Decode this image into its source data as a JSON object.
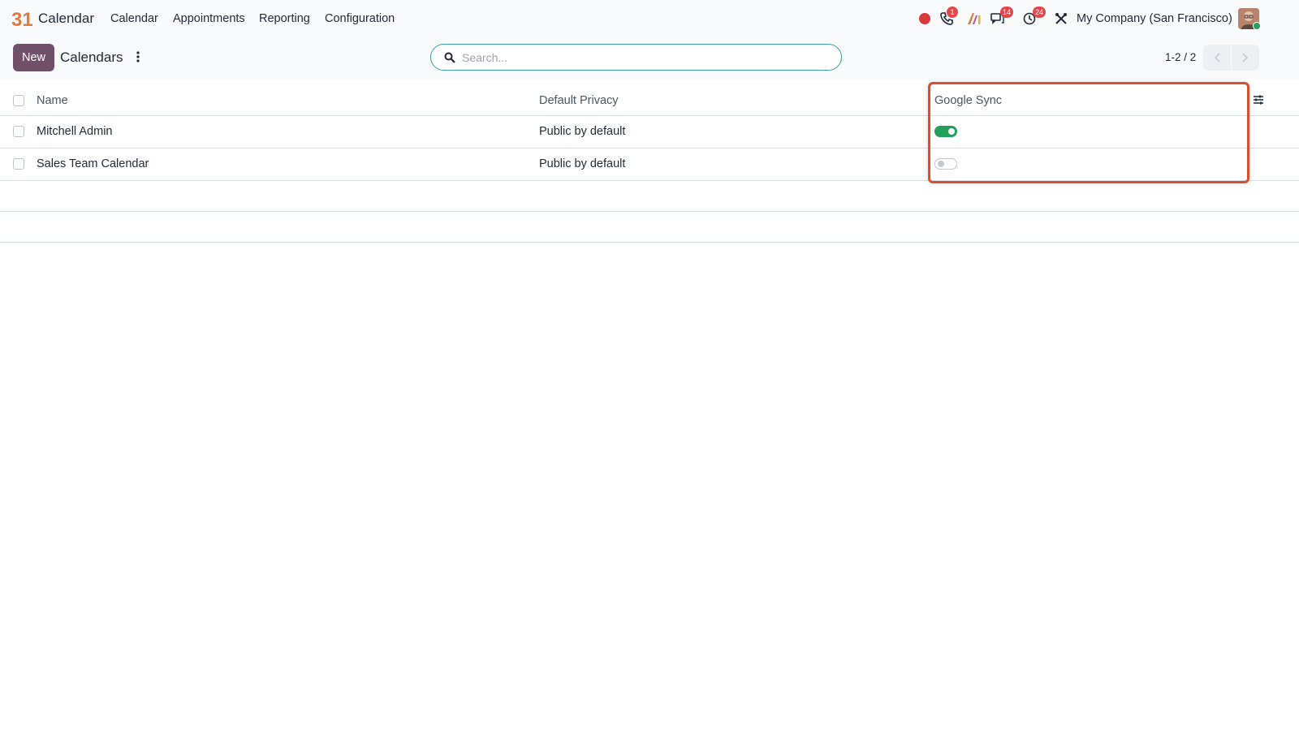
{
  "navbar": {
    "app_name": "Calendar",
    "logo_text": "31",
    "menu": [
      "Calendar",
      "Appointments",
      "Reporting",
      "Configuration"
    ],
    "badges": {
      "phone": "1",
      "messages": "14",
      "activities": "24"
    },
    "company": "My Company (San Francisco)"
  },
  "control": {
    "new_label": "New",
    "title": "Calendars",
    "search_placeholder": "Search...",
    "pager": "1-2 / 2"
  },
  "table": {
    "columns": [
      "Name",
      "Default Privacy",
      "Google Sync"
    ],
    "rows": [
      {
        "name": "Mitchell Admin",
        "privacy": "Public by default",
        "google_sync": true
      },
      {
        "name": "Sales Team Calendar",
        "privacy": "Public by default",
        "google_sync": false
      }
    ]
  },
  "colors": {
    "accent": "#71506a",
    "toggle_on": "#22a05a",
    "highlight": "#d5512f",
    "badge": "#e2474d"
  }
}
